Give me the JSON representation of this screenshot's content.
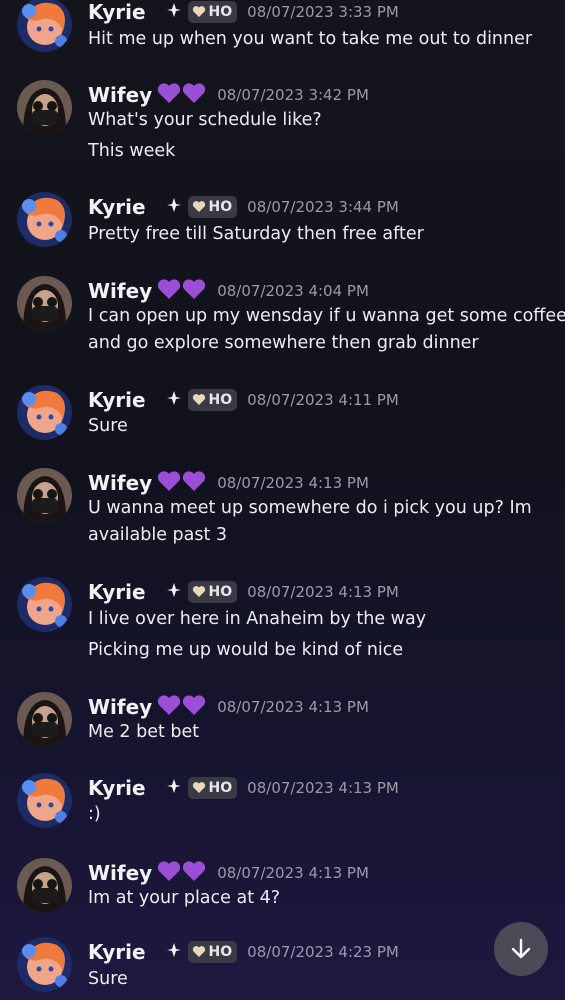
{
  "users": {
    "kyrie": {
      "name": "Kyrie",
      "name_icon": "moon-sparkle-icon",
      "tag_icon": "heart-icon",
      "tag": "HO"
    },
    "wifey": {
      "name": "Wifey",
      "name_icon": "purple-hearts-icon"
    }
  },
  "messages": [
    {
      "author": "Kyrie",
      "time": "08/07/2023 3:33 PM",
      "lines": [
        "Hit me up when you want to take me out to dinner"
      ]
    },
    {
      "author": "Wifey",
      "time": "08/07/2023 3:42 PM",
      "lines": [
        "What's your schedule like?",
        "This week"
      ]
    },
    {
      "author": "Kyrie",
      "time": "08/07/2023 3:44 PM",
      "lines": [
        "Pretty free till Saturday then free after"
      ]
    },
    {
      "author": "Wifey",
      "time": "08/07/2023 4:04 PM",
      "lines": [
        "I can open up my wensday if u wanna get some coffee",
        "and go explore somewhere then grab dinner"
      ]
    },
    {
      "author": "Kyrie",
      "time": "08/07/2023 4:11 PM",
      "lines": [
        "Sure"
      ]
    },
    {
      "author": "Wifey",
      "time": "08/07/2023 4:13 PM",
      "lines": [
        "U wanna meet up somewhere do i pick you up? Im",
        "available past 3"
      ]
    },
    {
      "author": "Kyrie",
      "time": "08/07/2023 4:13 PM",
      "lines": [
        "I live over here in Anaheim by the way",
        "Picking me up would be kind of nice"
      ]
    },
    {
      "author": "Wifey",
      "time": "08/07/2023 4:13 PM",
      "lines": [
        "Me 2 bet bet"
      ]
    },
    {
      "author": "Kyrie",
      "time": "08/07/2023 4:13 PM",
      "lines": [
        ":)"
      ]
    },
    {
      "author": "Wifey",
      "time": "08/07/2023 4:13 PM",
      "lines": [
        "Im at your place at 4?"
      ]
    },
    {
      "author": "Kyrie",
      "time": "08/07/2023 4:23 PM",
      "lines": [
        "Sure"
      ]
    }
  ],
  "scroll_button": {
    "icon": "arrow-down-icon"
  },
  "colors": {
    "accent_purple": "#9b4fd8",
    "tag_bg": "#3a3a44",
    "timestamp": "#9a9aa8"
  }
}
